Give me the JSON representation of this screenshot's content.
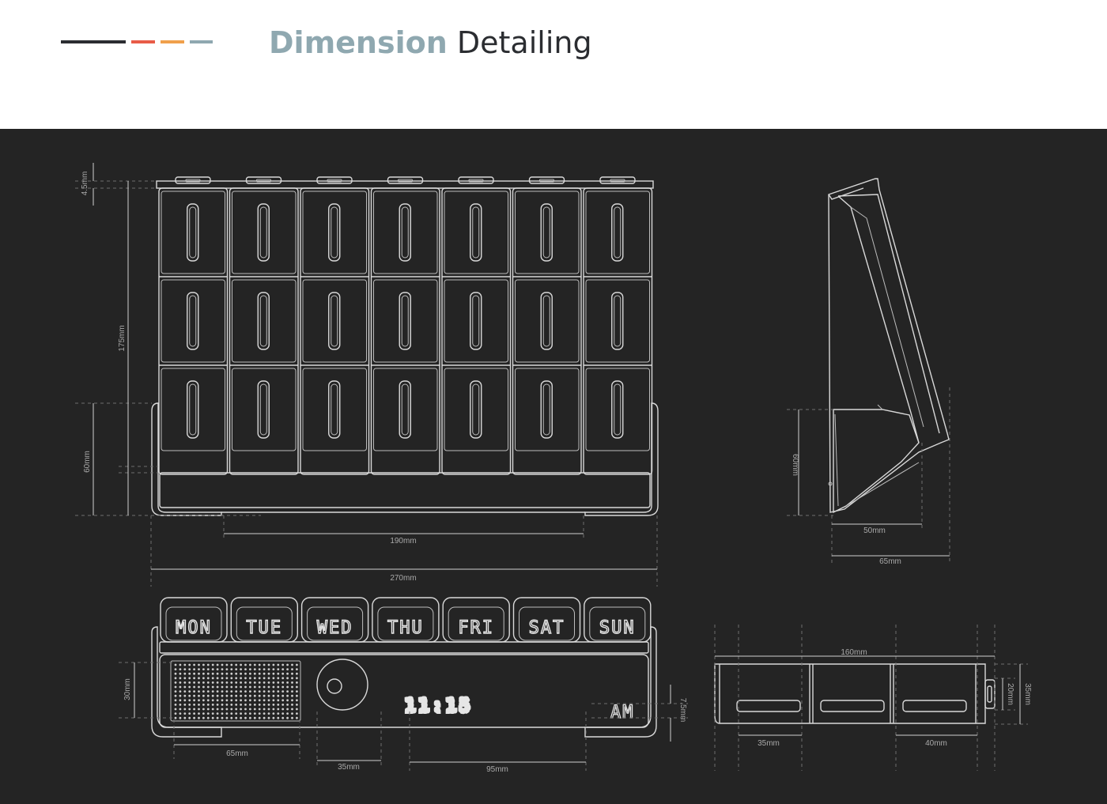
{
  "header": {
    "title_bold": "Dimension",
    "title_rest": "Detailing",
    "accent_colors": [
      "#2b2d31",
      "#e85c48",
      "#f0a04b",
      "#8fa8b0"
    ]
  },
  "theme": {
    "title_accent": "#8fa8b0",
    "stage_bg": "#242424",
    "line": "#d9d9d9"
  },
  "days": [
    "MON",
    "TUE",
    "WED",
    "THU",
    "FRI",
    "SAT",
    "SUN"
  ],
  "clock": {
    "time": "11:15",
    "meridiem": "AM"
  },
  "dimensions": {
    "front_lid": "4.5mm",
    "front_height": "175mm",
    "front_base": "60mm",
    "front_inner_width": "190mm",
    "front_total_width": "270mm",
    "side_height": "60mm",
    "side_base": "50mm",
    "side_total": "65mm",
    "display_height": "30mm",
    "speaker_width": "65mm",
    "knob_width": "35mm",
    "digits_width": "95mm",
    "digits_height": "7.5mm",
    "drawer_total": "160mm",
    "drawer_left": "35mm",
    "drawer_right": "40mm",
    "drawer_inner_h": "20mm",
    "drawer_outer_h": "35mm"
  }
}
